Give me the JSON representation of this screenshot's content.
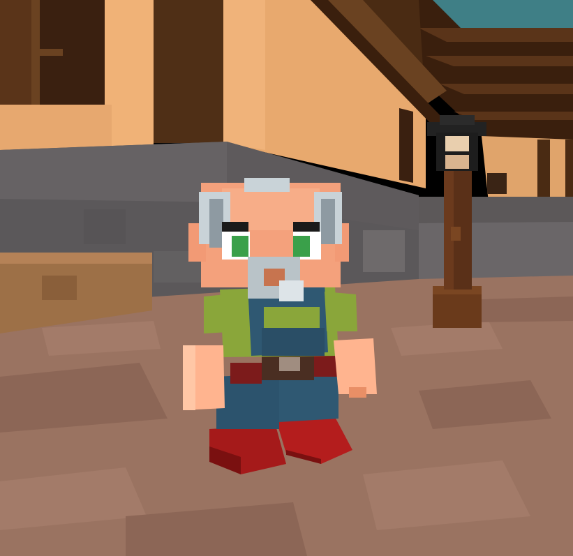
{
  "scene": {
    "description_kind": "voxel game screenshot",
    "palette": {
      "sky_teal": "#3f7f86",
      "wood_dark": "#4a2b13",
      "wood_mid": "#6a4221",
      "plaster": "#e2a56c",
      "plaster_light": "#f0b980",
      "stone": "#5d5a5c",
      "stone_light": "#6b6769",
      "floor": "#9a7361",
      "floor_dark": "#8a6555",
      "skin": "#f4a17c",
      "skin_light": "#ffc39e",
      "hair": "#c9d3d8",
      "hair_shadow": "#8e9aa2",
      "shirt_green": "#8aa63a",
      "overalls_blue": "#2f5872",
      "pants_red": "#7c1b1b",
      "shoes_red": "#b01d1d",
      "eye_green": "#3aa04a",
      "lamp_black": "#222222",
      "lamp_glow": "#e9cfae"
    },
    "entities": [
      {
        "id": "dwarf-npc",
        "kind": "character"
      },
      {
        "id": "lamp-post",
        "kind": "prop"
      },
      {
        "id": "wooden-building",
        "kind": "structure"
      },
      {
        "id": "stone-wall",
        "kind": "structure"
      },
      {
        "id": "wooden-crate-ledge",
        "kind": "structure"
      },
      {
        "id": "tiled-floor",
        "kind": "terrain"
      }
    ]
  }
}
